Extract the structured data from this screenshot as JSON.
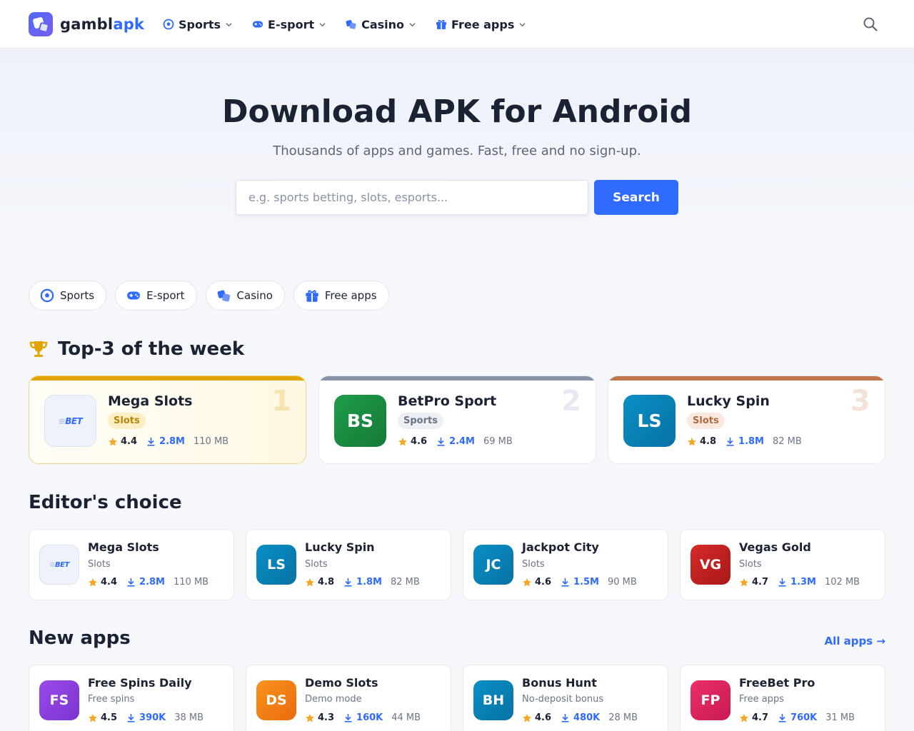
{
  "header": {
    "logo_part1": "gambl",
    "logo_part2": "apk",
    "nav": [
      {
        "label": "Sports",
        "icon": "soccer-ball-icon"
      },
      {
        "label": "E-sport",
        "icon": "gamepad-icon"
      },
      {
        "label": "Casino",
        "icon": "dice-icon"
      },
      {
        "label": "Free apps",
        "icon": "gift-icon"
      }
    ]
  },
  "hero": {
    "title": "Download APK for Android",
    "subtitle": "Thousands of apps and games. Fast, free and no sign-up.",
    "search_placeholder": "e.g. sports betting, slots, esports...",
    "search_button": "Search"
  },
  "chips": [
    {
      "label": "Sports"
    },
    {
      "label": "E-sport"
    },
    {
      "label": "Casino"
    },
    {
      "label": "Free apps"
    }
  ],
  "top3": {
    "title": "Top-3 of the week",
    "items": [
      {
        "rank": "1",
        "name": "Mega Slots",
        "tag": "Slots",
        "rating": "4.4",
        "downloads": "2.8M",
        "size": "110 MB",
        "logo_pre": "≡",
        "logo_text": "BET",
        "accent": "#e0a500"
      },
      {
        "rank": "2",
        "name": "BetPro Sport",
        "tag": "Sports",
        "rating": "4.6",
        "downloads": "2.4M",
        "size": "69 MB",
        "initials": "BS",
        "accent": "#8592a8"
      },
      {
        "rank": "3",
        "name": "Lucky Spin",
        "tag": "Slots",
        "rating": "4.8",
        "downloads": "1.8M",
        "size": "82 MB",
        "initials": "LS",
        "accent": "#c0774a"
      }
    ]
  },
  "editors_choice": {
    "title": "Editor's choice",
    "items": [
      {
        "name": "Mega Slots",
        "category": "Slots",
        "rating": "4.4",
        "downloads": "2.8M",
        "size": "110 MB",
        "logo_pre": "≡",
        "logo_text": "BET"
      },
      {
        "name": "Lucky Spin",
        "category": "Slots",
        "rating": "4.8",
        "downloads": "1.8M",
        "size": "82 MB",
        "initials": "LS"
      },
      {
        "name": "Jackpot City",
        "category": "Slots",
        "rating": "4.6",
        "downloads": "1.5M",
        "size": "90 MB",
        "initials": "JC"
      },
      {
        "name": "Vegas Gold",
        "category": "Slots",
        "rating": "4.7",
        "downloads": "1.3M",
        "size": "102 MB",
        "initials": "VG"
      }
    ]
  },
  "new_apps": {
    "title": "New apps",
    "all_link": "All apps →",
    "items": [
      {
        "name": "Free Spins Daily",
        "category": "Free spins",
        "rating": "4.5",
        "downloads": "390K",
        "size": "38 MB",
        "initials": "FS"
      },
      {
        "name": "Demo Slots",
        "category": "Demo mode",
        "rating": "4.3",
        "downloads": "160K",
        "size": "44 MB",
        "initials": "DS"
      },
      {
        "name": "Bonus Hunt",
        "category": "No-deposit bonus",
        "rating": "4.6",
        "downloads": "480K",
        "size": "28 MB",
        "initials": "BH"
      },
      {
        "name": "FreeBet Pro",
        "category": "Free apps",
        "rating": "4.7",
        "downloads": "760K",
        "size": "31 MB",
        "initials": "FP"
      }
    ]
  },
  "colors": {
    "accent": "#2f6bff",
    "gold": "#e0a500",
    "silver": "#8592a8",
    "bronze": "#c0774a",
    "star": "#f5a623"
  }
}
